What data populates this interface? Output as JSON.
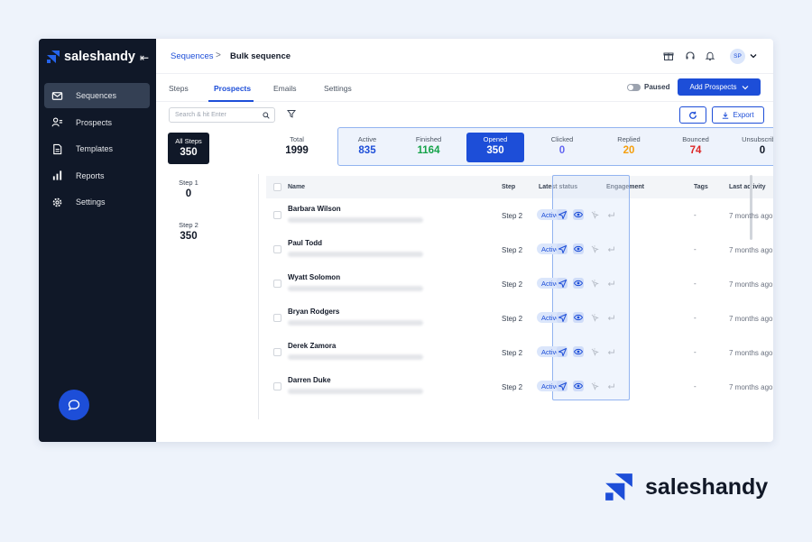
{
  "brand": {
    "name": "saleshandy",
    "accent": "#1d4ed8"
  },
  "sidebar": {
    "items": [
      {
        "label": "Sequences",
        "icon": "mail-icon",
        "active": true
      },
      {
        "label": "Prospects",
        "icon": "prospects-icon",
        "active": false
      },
      {
        "label": "Templates",
        "icon": "document-icon",
        "active": false
      },
      {
        "label": "Reports",
        "icon": "bar-chart-icon",
        "active": false
      },
      {
        "label": "Settings",
        "icon": "gear-icon",
        "active": false
      }
    ]
  },
  "header": {
    "breadcrumb_link": "Sequences",
    "separator": ">",
    "title": "Bulk sequence",
    "avatar_initials": "SP"
  },
  "tabs": [
    {
      "label": "Steps"
    },
    {
      "label": "Prospects",
      "active": true
    },
    {
      "label": "Emails"
    },
    {
      "label": "Settings"
    }
  ],
  "controls": {
    "paused_label": "Paused",
    "paused_on": false,
    "add_button": "Add Prospects",
    "search_placeholder": "Search & hit Enter",
    "export_label": "Export"
  },
  "steps": [
    {
      "label": "All Steps",
      "value": "350"
    },
    {
      "label": "Step 1",
      "value": "0"
    },
    {
      "label": "Step 2",
      "value": "350"
    }
  ],
  "total": {
    "label": "Total",
    "value": "1999"
  },
  "stats": [
    {
      "label": "Active",
      "value": "835",
      "color": "#1d4ed8"
    },
    {
      "label": "Finished",
      "value": "1164",
      "color": "#16a34a"
    },
    {
      "label": "Opened",
      "value": "350",
      "color": "#ffffff",
      "selected": true
    },
    {
      "label": "Clicked",
      "value": "0",
      "color": "#6366f1"
    },
    {
      "label": "Replied",
      "value": "20",
      "color": "#f59e0b"
    },
    {
      "label": "Bounced",
      "value": "74",
      "color": "#dc2626"
    },
    {
      "label": "Unsubscribed",
      "value": "0",
      "color": "#111827"
    }
  ],
  "table": {
    "columns": [
      "Name",
      "Step",
      "Latest status",
      "Engagement",
      "Tags",
      "Last activity"
    ],
    "rows": [
      {
        "name": "Barbara Wilson",
        "step": "Step 2",
        "status": "Active",
        "tags": "-",
        "last_activity": "7 months ago"
      },
      {
        "name": "Paul Todd",
        "step": "Step 2",
        "status": "Active",
        "tags": "-",
        "last_activity": "7 months ago"
      },
      {
        "name": "Wyatt Solomon",
        "step": "Step 2",
        "status": "Active",
        "tags": "-",
        "last_activity": "7 months ago"
      },
      {
        "name": "Bryan Rodgers",
        "step": "Step 2",
        "status": "Active",
        "tags": "-",
        "last_activity": "7 months ago"
      },
      {
        "name": "Derek Zamora",
        "step": "Step 2",
        "status": "Active",
        "tags": "-",
        "last_activity": "7 months ago"
      },
      {
        "name": "Darren Duke",
        "step": "Step 2",
        "status": "Active",
        "tags": "-",
        "last_activity": "7 months ago"
      }
    ]
  },
  "footer_brand": {
    "name": "saleshandy"
  }
}
